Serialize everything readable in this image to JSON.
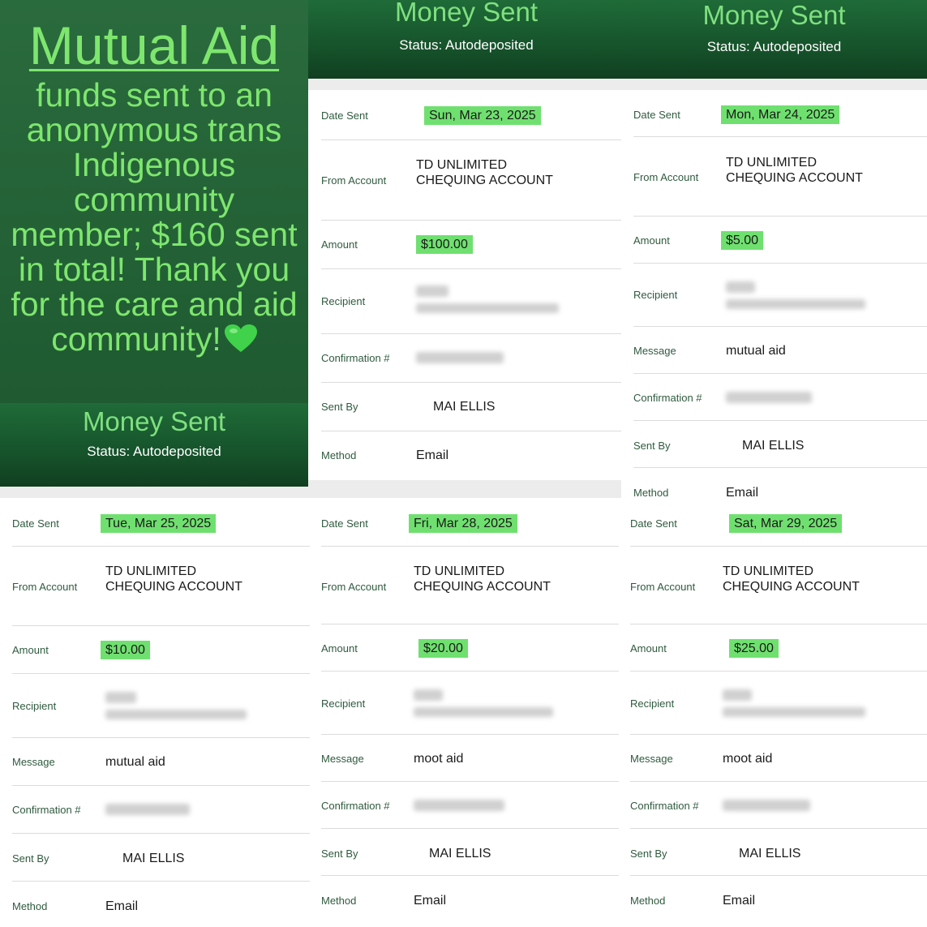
{
  "title_panel": {
    "heading": "Mutual Aid",
    "body": "funds sent to an anonymous trans Indigenous community member; $160 sent in total! Thank you for the care and aid community!",
    "icon": "green-heart-emoji",
    "accent_color": "#7ee66e"
  },
  "header": {
    "title": "Money Sent",
    "status": "Status: Autodeposited"
  },
  "labels": {
    "date_sent": "Date Sent",
    "from_account": "From Account",
    "amount": "Amount",
    "recipient": "Recipient",
    "message": "Message",
    "confirmation": "Confirmation #",
    "sent_by": "Sent By",
    "method": "Method"
  },
  "from_account_line1": "TD UNLIMITED",
  "from_account_line2": "CHEQUING ACCOUNT",
  "transfers": [
    {
      "date": "Sun, Mar 23, 2025",
      "amount": "$100.00",
      "message": "",
      "sent_by": "MAI ELLIS",
      "method": "Email"
    },
    {
      "date": "Mon, Mar 24, 2025",
      "amount": "$5.00",
      "message": "mutual aid",
      "sent_by": "MAI ELLIS",
      "method": "Email"
    },
    {
      "date": "Tue, Mar 25, 2025",
      "amount": "$10.00",
      "message": "mutual aid",
      "sent_by": "MAI ELLIS",
      "method": "Email"
    },
    {
      "date": "Fri, Mar 28, 2025",
      "amount": "$20.00",
      "message": "moot aid",
      "sent_by": "MAI ELLIS",
      "method": "Email"
    },
    {
      "date": "Sat, Mar 29, 2025",
      "amount": "$25.00",
      "message": "moot aid",
      "sent_by": "MAI ELLIS",
      "method": "Email"
    }
  ],
  "colors": {
    "highlight": "#6fe06f",
    "header_dark": "#16532b",
    "label_text": "#2f5a3e"
  }
}
